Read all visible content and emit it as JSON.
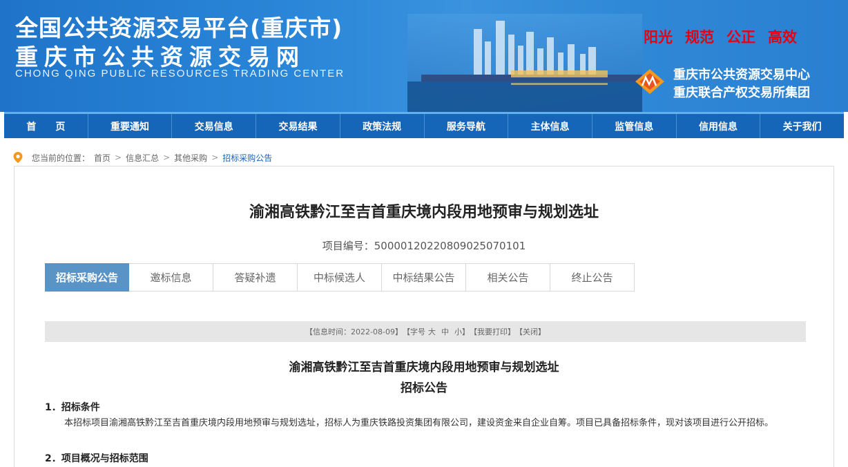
{
  "header": {
    "title_line1": "全国公共资源交易平台(重庆市)",
    "title_line2": "重庆市公共资源交易网",
    "title_en": "CHONG QING PUBLIC RESOURCES TRADING CENTER",
    "slogans": [
      "阳光",
      "规范",
      "公正",
      "高效"
    ],
    "org_line1": "重庆市公共资源交易中心",
    "org_line2": "重庆联合产权交易所集团"
  },
  "nav": {
    "items": [
      "首　　页",
      "重要通知",
      "交易信息",
      "交易结果",
      "政策法规",
      "服务导航",
      "主体信息",
      "监管信息",
      "信用信息",
      "关于我们"
    ]
  },
  "breadcrumb": {
    "prefix": "您当前的位置：",
    "items": [
      "首页",
      "信息汇总",
      "其他采购",
      "招标采购公告"
    ],
    "separator": ">"
  },
  "project": {
    "title": "渝湘高铁黔江至吉首重庆境内段用地预审与规划选址",
    "number_label": "项目编号：500001202208090250701​01",
    "number_display": "项目编号：500001202208090250701​01"
  },
  "tabs": [
    "招标采购公告",
    "邀标信息",
    "答疑补遗",
    "中标候选人",
    "中标结果公告",
    "相关公告",
    "终止公告"
  ],
  "infobar": {
    "time": "【信息时间：2022-08-09】",
    "font_label": "【字号",
    "font_large": "大",
    "font_medium": "中",
    "font_small": "小】",
    "print": "【我要打印】",
    "close": "【关闭】"
  },
  "document": {
    "title": "渝湘高铁黔江至吉首重庆境内段用地预审与规划选址",
    "subtitle": "招标公告",
    "section1_heading": "1．招标条件",
    "section1_text": "本招标项目渝湘高铁黔江至吉首重庆境内段用地预审与规划选址，招标人为重庆铁路投资集团有限公司，建设资金来自企业自筹。项目已具备招标条件，现对该项目进行公开招标。",
    "section2_heading": "2．项目概况与招标范围"
  },
  "colors": {
    "nav_bg": "#1565b8",
    "tab_active": "#5a93c6",
    "slogan": "#e60012",
    "link_current": "#1a64b5"
  }
}
